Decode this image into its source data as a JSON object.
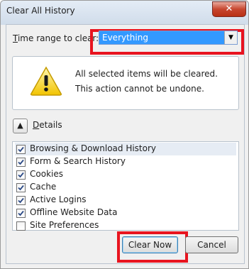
{
  "window": {
    "title": "Clear All History",
    "close_glyph": "✕"
  },
  "time_range": {
    "label_prefix": "T",
    "label_rest": "ime range to clear:",
    "selected": "Everything",
    "highlight_color": "#e8141f"
  },
  "warning": {
    "icon": "warning-triangle-icon",
    "line1": "All selected items will be cleared.",
    "line2": "This action cannot be undone."
  },
  "details": {
    "label_prefix": "D",
    "label_rest": "etails"
  },
  "items": [
    {
      "label": "Browsing & Download History",
      "checked": true,
      "selected": true
    },
    {
      "label": "Form & Search History",
      "checked": true
    },
    {
      "label": "Cookies",
      "checked": true
    },
    {
      "label": "Cache",
      "checked": true
    },
    {
      "label": "Active Logins",
      "checked": true
    },
    {
      "label": "Offline Website Data",
      "checked": true
    },
    {
      "label": "Site Preferences",
      "checked": false
    }
  ],
  "buttons": {
    "clear_now": "Clear Now",
    "cancel": "Cancel"
  }
}
